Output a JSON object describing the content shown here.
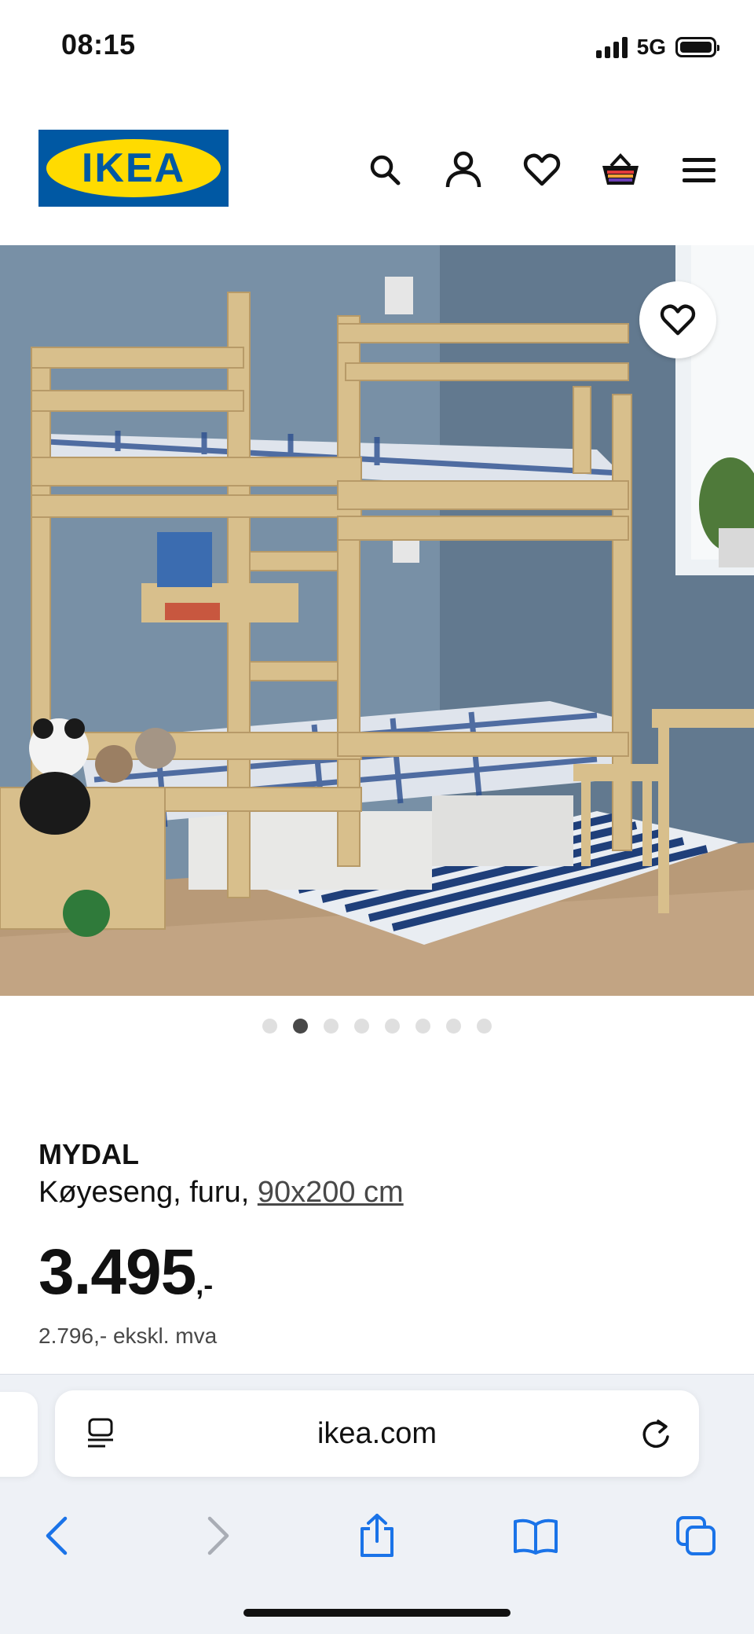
{
  "status": {
    "time": "08:15",
    "network": "5G"
  },
  "header": {
    "logo_text": "IKEA",
    "icons": [
      "search-icon",
      "account-icon",
      "favourites-icon",
      "basket-icon",
      "menu-icon"
    ]
  },
  "gallery": {
    "image_count": 8,
    "active_index": 1
  },
  "product": {
    "name": "MYDAL",
    "description": "Køyeseng, furu, ",
    "size": "90x200 cm",
    "price_main": "3.495",
    "price_suffix": ",-",
    "price_ex_vat": "2.796,- ekskl. mva"
  },
  "browser": {
    "url": "ikea.com",
    "toolbar": [
      "back-icon",
      "forward-icon",
      "share-icon",
      "bookmarks-icon",
      "tabs-icon"
    ]
  },
  "colors": {
    "ikea_blue": "#0058a3",
    "ikea_yellow": "#ffdb00",
    "safari_blue": "#1a73e8"
  }
}
